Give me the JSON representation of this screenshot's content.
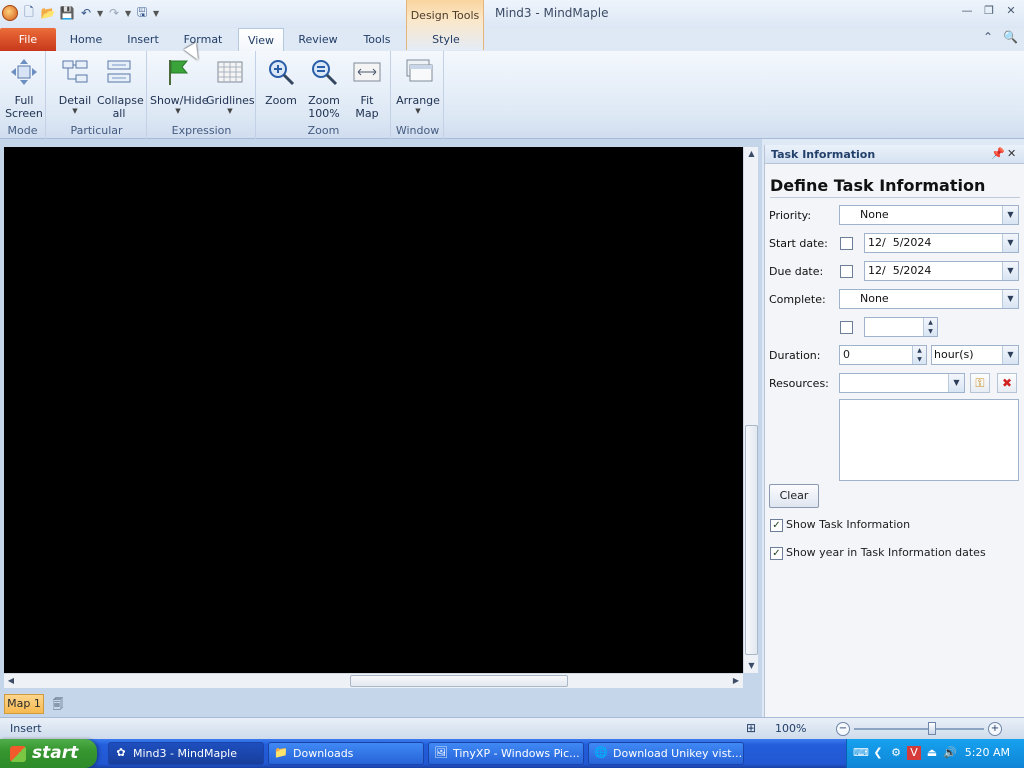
{
  "titlebar": {
    "contextual_tab": "Design Tools",
    "window_title": "Mind3 - MindMaple"
  },
  "tabs": {
    "file": "File",
    "home": "Home",
    "insert": "Insert",
    "format": "Format",
    "view": "View",
    "review": "Review",
    "tools": "Tools",
    "style": "Style"
  },
  "ribbon": {
    "mode": {
      "label": "Mode",
      "full_screen": "Full\nScreen"
    },
    "particular": {
      "label": "Particular",
      "detail": "Detail",
      "collapse_all": "Collapse\nall"
    },
    "expression": {
      "label": "Expression",
      "show_hide": "Show/Hide",
      "gridlines": "Gridlines"
    },
    "zoom": {
      "label": "Zoom",
      "zoom": "Zoom",
      "zoom_100": "Zoom\n100%",
      "fit_map": "Fit\nMap"
    },
    "window": {
      "label": "Window",
      "arrange": "Arrange"
    }
  },
  "sheet_tabs": {
    "map1": "Map 1"
  },
  "task_panel": {
    "header": "Task Information",
    "title": "Define Task Information",
    "priority_label": "Priority:",
    "priority_value": "None",
    "start_date_label": "Start date:",
    "start_date_value": "12/  5/2024",
    "due_date_label": "Due date:",
    "due_date_value": "12/  5/2024",
    "complete_label": "Complete:",
    "complete_value": "None",
    "duration_label": "Duration:",
    "duration_value": "0",
    "duration_unit": "hour(s)",
    "resources_label": "Resources:",
    "clear_button": "Clear",
    "show_task_info": "Show Task Information",
    "show_year": "Show year in Task Information dates"
  },
  "statusbar": {
    "mode": "Insert",
    "zoom_pct": "100%",
    "zoom_level": 0.6
  },
  "taskbar": {
    "start": "start",
    "items": [
      {
        "label": "Mind3 - MindMaple"
      },
      {
        "label": "Downloads"
      },
      {
        "label": "TinyXP - Windows Pic..."
      },
      {
        "label": "Download Unikey vist..."
      }
    ],
    "clock": "5:20 AM"
  }
}
